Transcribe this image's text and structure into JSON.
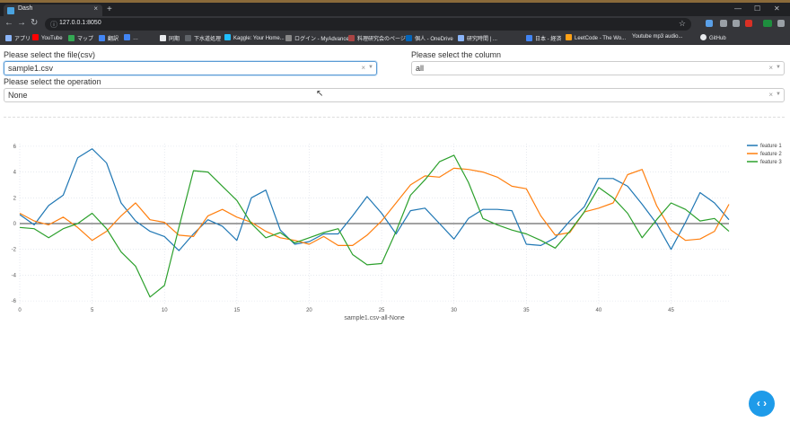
{
  "browser": {
    "tab_title": "Dash",
    "tab_close": "×",
    "new_tab": "+",
    "url": "127.0.0.1:8050",
    "window_controls": [
      "—",
      "☐",
      "✕"
    ],
    "bookmarks": [
      {
        "label": "アプリ",
        "color": "#8ab4f8"
      },
      {
        "label": "YouTube",
        "color": "#ff0000"
      },
      {
        "label": "マップ",
        "color": "#34a853"
      },
      {
        "label": "翻訳",
        "color": "#4285f4"
      },
      {
        "label": "",
        "color": "#5f6368"
      },
      {
        "label": "…",
        "color": "#4285f4"
      },
      {
        "label": "同期",
        "color": "#e8eaed"
      },
      {
        "label": "下水道処理",
        "color": "#5f6368"
      },
      {
        "label": "Kaggle: Your Home...",
        "color": "#20beff"
      },
      {
        "label": "ログイン - MyAdvance",
        "color": "#888"
      },
      {
        "label": "料理研究会のページ",
        "color": "#aa4444"
      },
      {
        "label": "個人 - OneDrive",
        "color": "#0364b8"
      },
      {
        "label": "研究時間 | ...",
        "color": "#8ab4f8"
      },
      {
        "label": "日本 - 経済",
        "color": "#4285f4"
      },
      {
        "label": "LeetCode - The Wo...",
        "color": "#ffa116"
      },
      {
        "label": "Youtube mp3 audio...",
        "color": "#cc0000"
      },
      {
        "label": "GitHub",
        "color": "#e8eaed"
      }
    ]
  },
  "controls": {
    "file_label": "Please select the file(csv)",
    "file_value": "sample1.csv",
    "column_label": "Please select the column",
    "column_value": "all",
    "operation_label": "Please select the operation",
    "operation_value": "None",
    "clear_symbol": "×",
    "arrow_symbol": "▼"
  },
  "chart_data": {
    "type": "line",
    "title": "",
    "xlabel": "sample1.csv-all-None",
    "ylabel": "",
    "xlim": [
      0,
      49
    ],
    "ylim": [
      -6.2,
      6.2
    ],
    "xticks": [
      0,
      5,
      10,
      15,
      20,
      25,
      30,
      35,
      40,
      45
    ],
    "yticks": [
      -6,
      -4,
      -2,
      0,
      2,
      4,
      6
    ],
    "grid": true,
    "legend_position": "top-right",
    "series": [
      {
        "name": "feature 1",
        "color": "#1f77b4",
        "values": [
          0.7,
          -0.1,
          1.4,
          2.2,
          5.1,
          5.8,
          4.7,
          1.6,
          0.2,
          -0.6,
          -1.0,
          -2.1,
          -0.8,
          0.3,
          -0.2,
          -1.3,
          2.0,
          2.6,
          -0.5,
          -1.6,
          -1.4,
          -0.8,
          -0.8,
          0.6,
          2.1,
          0.8,
          -0.8,
          1.0,
          1.2,
          0.0,
          -1.2,
          0.4,
          1.1,
          1.1,
          1.0,
          -1.6,
          -1.7,
          -1.1,
          0.2,
          1.3,
          3.5,
          3.5,
          2.9,
          1.5,
          0.0,
          -2.0,
          0.1,
          2.4,
          1.6,
          0.3
        ]
      },
      {
        "name": "feature 2",
        "color": "#ff7f0e",
        "values": [
          0.8,
          0.2,
          -0.1,
          0.5,
          -0.3,
          -1.3,
          -0.6,
          0.6,
          1.6,
          0.3,
          0.1,
          -0.9,
          -1.0,
          0.6,
          1.1,
          0.5,
          0.1,
          -0.6,
          -1.1,
          -1.3,
          -1.6,
          -1.0,
          -1.7,
          -1.7,
          -0.9,
          0.2,
          1.6,
          3.0,
          3.7,
          3.6,
          4.3,
          4.2,
          4.0,
          3.6,
          2.9,
          2.7,
          0.6,
          -0.9,
          -0.7,
          0.9,
          1.2,
          1.6,
          3.8,
          4.2,
          1.4,
          -0.5,
          -1.3,
          -1.2,
          -0.6,
          1.5
        ]
      },
      {
        "name": "feature 3",
        "color": "#2ca02c",
        "values": [
          -0.3,
          -0.4,
          -1.1,
          -0.4,
          0.0,
          0.8,
          -0.4,
          -2.2,
          -3.3,
          -5.7,
          -4.8,
          -0.3,
          4.1,
          4.0,
          2.9,
          1.8,
          0.0,
          -1.1,
          -0.7,
          -1.5,
          -1.1,
          -0.7,
          -0.4,
          -2.4,
          -3.2,
          -3.1,
          -0.6,
          2.2,
          3.4,
          4.8,
          5.3,
          3.2,
          0.4,
          -0.1,
          -0.5,
          -0.8,
          -1.3,
          -1.9,
          -0.6,
          0.9,
          2.8,
          2.0,
          0.8,
          -1.1,
          0.3,
          1.6,
          1.1,
          0.2,
          0.4,
          -0.6
        ]
      }
    ]
  },
  "fab_label": "‹ ›"
}
